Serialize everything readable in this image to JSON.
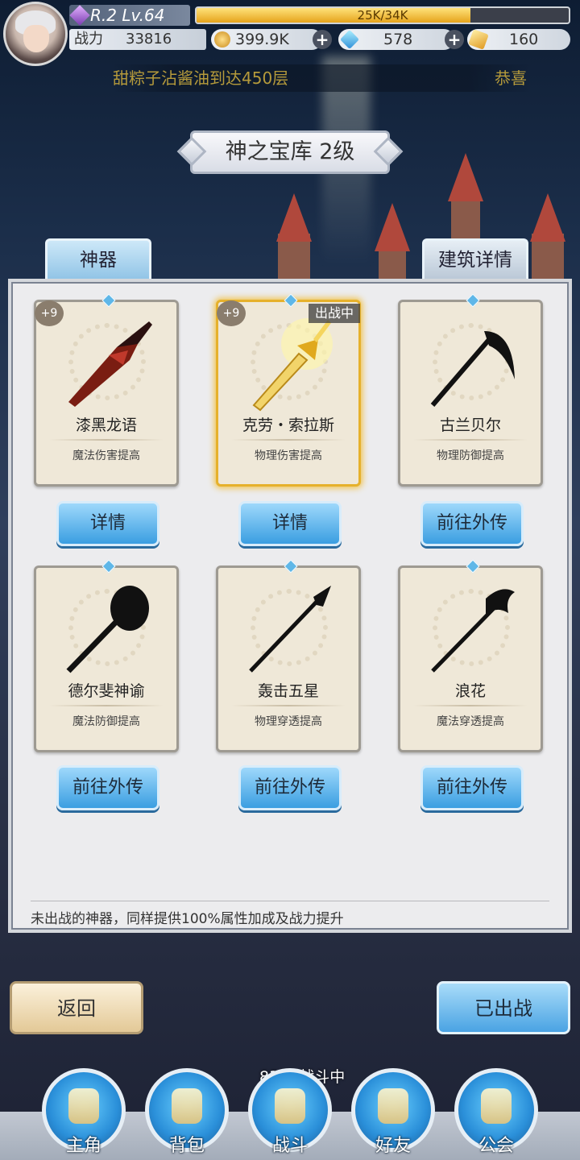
{
  "player": {
    "rank_level": "R.2 Lv.64",
    "exp_text": "25K/34K",
    "exp_progress": 0.735,
    "power_label": "战力",
    "power_value": "33816"
  },
  "currencies": [
    {
      "icon": "gold-coin-icon",
      "value": "399.9K"
    },
    {
      "icon": "blue-diamond-icon",
      "value": "578"
    },
    {
      "icon": "gold-crystal-icon",
      "value": "160"
    }
  ],
  "marquee": {
    "text": "甜粽子沾酱油到达450层",
    "tail": "恭喜"
  },
  "page_title": "神之宝库 2级",
  "tabs": {
    "artifacts": "神器",
    "building_details": "建筑详情"
  },
  "cards": [
    {
      "name": "漆黑龙语",
      "effect": "魔法伤害提高",
      "badge": "+9",
      "button": "详情",
      "deployed": ""
    },
    {
      "name": "克劳・索拉斯",
      "effect": "物理伤害提高",
      "badge": "+9",
      "button": "详情",
      "deployed": "出战中"
    },
    {
      "name": "古兰贝尔",
      "effect": "物理防御提高",
      "badge": "",
      "button": "前往外传",
      "deployed": ""
    },
    {
      "name": "德尔斐神谕",
      "effect": "魔法防御提高",
      "badge": "",
      "button": "前往外传",
      "deployed": ""
    },
    {
      "name": "轰击五星",
      "effect": "物理穿透提高",
      "badge": "",
      "button": "前往外传",
      "deployed": ""
    },
    {
      "name": "浪花",
      "effect": "魔法穿透提高",
      "badge": "",
      "button": "前往外传",
      "deployed": ""
    }
  ],
  "footer_note": "未出战的神器，同样提供100%属性加成及战力提升",
  "actions": {
    "back": "返回",
    "deployed": "已出战"
  },
  "battle_status": "83层 战斗中",
  "nav": [
    "主角",
    "背包",
    "战斗",
    "好友",
    "公会"
  ],
  "colors": {
    "accent_blue": "#3a9ee1",
    "gold": "#e6b12c",
    "panel": "#ececee"
  }
}
